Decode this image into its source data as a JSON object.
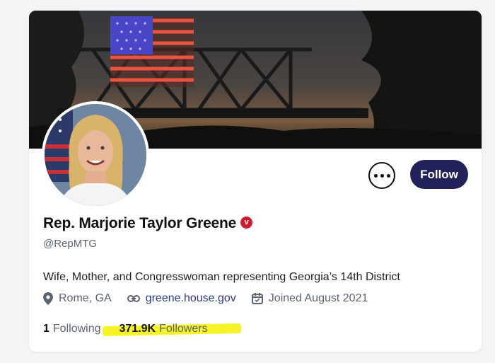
{
  "profile": {
    "display_name": "Rep. Marjorie Taylor Greene",
    "verified_mark": "v",
    "handle": "@RepMTG",
    "bio": "Wife, Mother, and Congresswoman representing Georgia’s 14th District",
    "location": "Rome, GA",
    "website": "greene.house.gov",
    "joined": "Joined August 2021"
  },
  "actions": {
    "follow_label": "Follow"
  },
  "stats": {
    "following_count": "1",
    "following_label": "Following",
    "followers_count": "371.9K",
    "followers_label": "Followers"
  },
  "icons": {
    "more": "more-options-icon",
    "location": "location-pin-icon",
    "link": "link-icon",
    "calendar": "calendar-icon",
    "verified": "verified-badge-icon"
  },
  "colors": {
    "follow_button": "#23215a",
    "verified_badge": "#d0192f",
    "highlight": "#f6f21a",
    "link": "#2a3a8c"
  }
}
